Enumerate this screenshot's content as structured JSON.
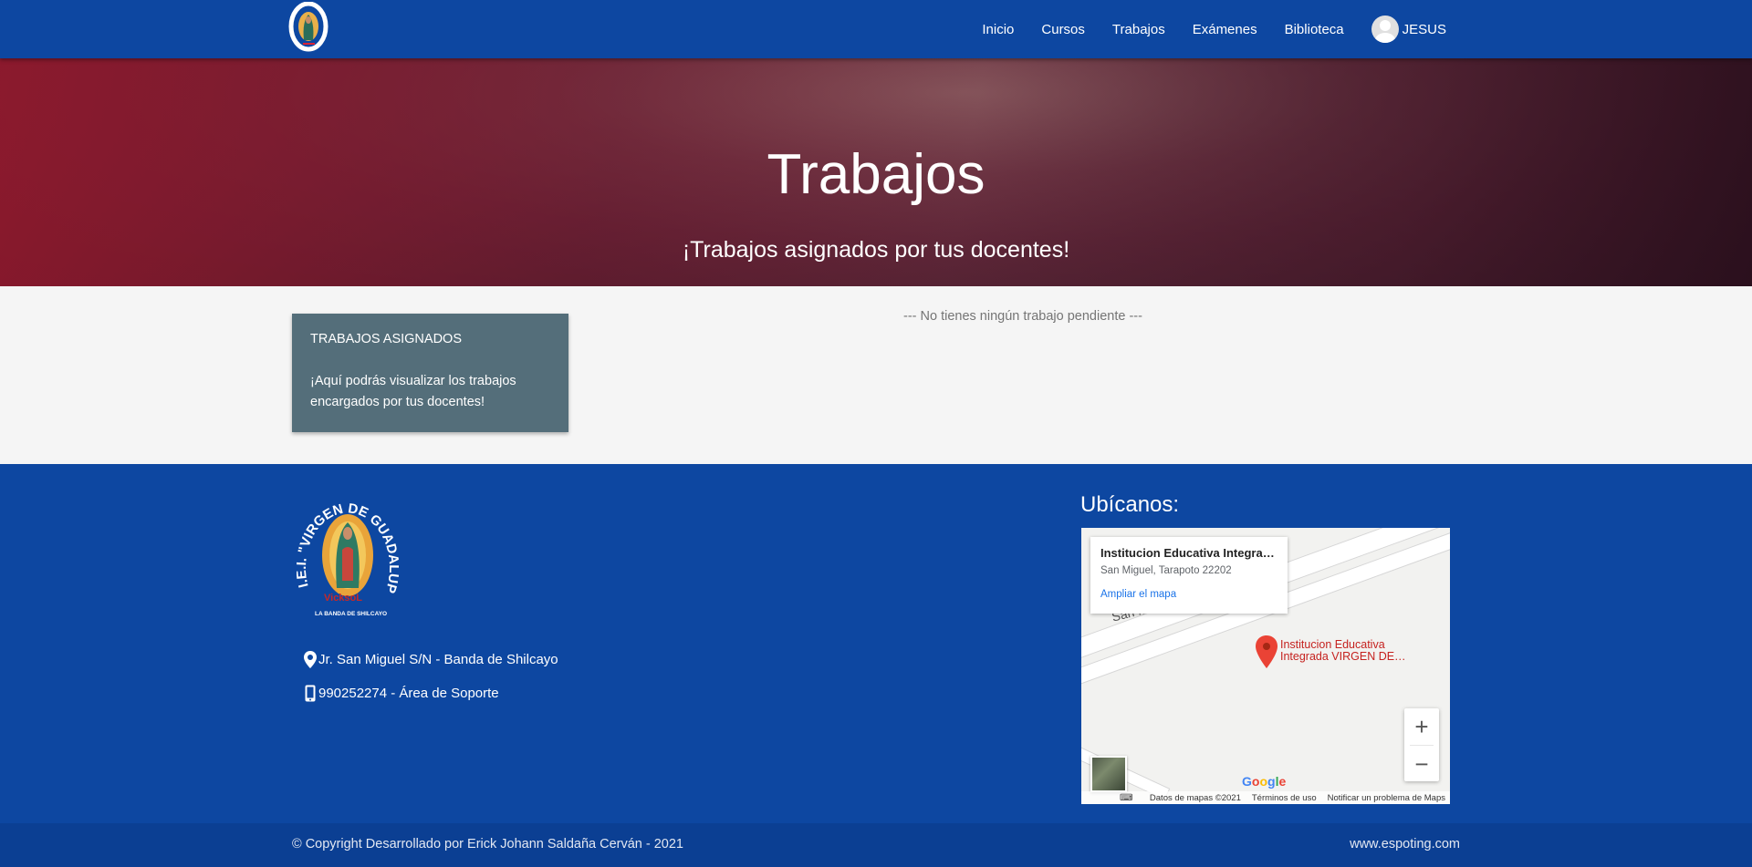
{
  "colors": {
    "nav": "#0d47a1",
    "hero": "#7a1f35",
    "card": "#546e7a",
    "footer": "#0d47a1"
  },
  "navbar": {
    "logo_icon": "school-logo-icon",
    "links": [
      "Inicio",
      "Cursos",
      "Trabajos",
      "Exámenes",
      "Biblioteca"
    ],
    "user": "JESUS",
    "user_icon": "user-avatar-icon"
  },
  "hero": {
    "title": "Trabajos",
    "subtitle": "¡Trabajos asignados por tus docentes!"
  },
  "card": {
    "title": "TRABAJOS ASIGNADOS",
    "text": "¡Aquí podrás visualizar los trabajos encargados por tus docentes!"
  },
  "empty_message": "--- No tienes ningún trabajo pendiente ---",
  "footer": {
    "logo_text": "I.E.I. \"VIRGEN DE GUADALUPE\"",
    "logo_subtext": "LA BANDA DE SHILCAYO",
    "address": "Jr. San Miguel S/N - Banda de Shilcayo",
    "phone": "990252274 - Área de Soporte",
    "map_title": "Ubícanos:",
    "map": {
      "place_name": "Institucion Educativa Integrada VIRGEN DE GUADALUPE",
      "place_address": "San Miguel, Tarapoto 22202",
      "expand_link": "Ampliar el mapa",
      "pin_label": "Institucion Educativa Integrada VIRGEN DE…",
      "street": "San M",
      "google": "Google",
      "attribution": [
        "Datos de mapas ©2021",
        "Términos de uso",
        "Notificar un problema de Maps"
      ],
      "zoom_in": "+",
      "zoom_out": "−"
    },
    "copyright": "© Copyright Desarrollado por Erick Johann Saldaña Cerván - 2021",
    "site": "www.espoting.com"
  }
}
